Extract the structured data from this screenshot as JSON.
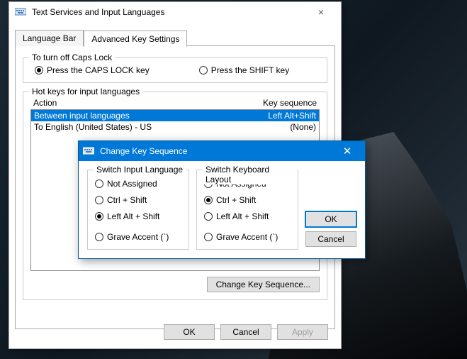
{
  "mainDialog": {
    "title": "Text Services and Input Languages",
    "tabs": {
      "languageBar": "Language Bar",
      "advanced": "Advanced Key Settings"
    },
    "capsGroup": {
      "label": "To turn off Caps Lock",
      "optCaps": "Press the CAPS LOCK key",
      "optShift": "Press the SHIFT key"
    },
    "hotkeys": {
      "label": "Hot keys for input languages",
      "colAction": "Action",
      "colSeq": "Key sequence",
      "rows": [
        {
          "action": "Between input languages",
          "seq": "Left Alt+Shift"
        },
        {
          "action": "To English (United States) - US",
          "seq": "(None)"
        }
      ],
      "changeBtn": "Change Key Sequence..."
    },
    "buttons": {
      "ok": "OK",
      "cancel": "Cancel",
      "apply": "Apply"
    }
  },
  "modal": {
    "title": "Change Key Sequence",
    "inputLang": {
      "label": "Switch Input Language",
      "notAssigned": "Not Assigned",
      "ctrlShift": "Ctrl + Shift",
      "leftAltShift": "Left Alt + Shift",
      "grave": "Grave Accent (`)"
    },
    "kbLayout": {
      "label": "Switch Keyboard Layout",
      "notAssigned": "Not Assigned",
      "ctrlShift": "Ctrl + Shift",
      "leftAltShift": "Left Alt + Shift",
      "grave": "Grave Accent (`)"
    },
    "buttons": {
      "ok": "OK",
      "cancel": "Cancel"
    }
  }
}
